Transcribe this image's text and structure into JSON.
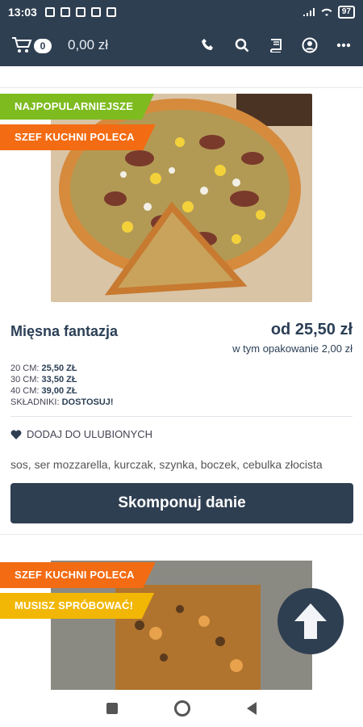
{
  "status_bar": {
    "time": "13:03",
    "battery": "97"
  },
  "header": {
    "cart_count": "0",
    "cart_total": "0,00 zł",
    "icons": [
      "phone-icon",
      "search-icon",
      "menu-book-icon",
      "account-icon",
      "more-icon"
    ]
  },
  "products": [
    {
      "ribbons": [
        "NAJPOPULARNIEJSZE",
        "SZEF KUCHNI POLECA"
      ],
      "title": "Mięsna fantazja",
      "price_from": "od 25,50 zł",
      "packaging": "w tym opakowanie 2,00 zł",
      "sizes": [
        {
          "label": "20 CM:",
          "price": "25,50 ZŁ"
        },
        {
          "label": "30 CM:",
          "price": "33,50 ZŁ"
        },
        {
          "label": "40 CM:",
          "price": "39,00 ZŁ"
        }
      ],
      "ingredients_label": "SKŁADNIKI:",
      "ingredients_link": "DOSTOSUJ!",
      "favorite_label": "DODAJ DO ULUBIONYCH",
      "ingredients": "sos, ser mozzarella, kurczak, szynka, boczek, cebulka złocista",
      "compose_button": "Skomponuj danie"
    },
    {
      "ribbons": [
        "SZEF KUCHNI POLECA",
        "MUSISZ SPRÓBOWAĆ!"
      ]
    }
  ],
  "colors": {
    "primary": "#2f3f52",
    "ribbon_green": "#7dbb1f",
    "ribbon_orange": "#f36b12",
    "ribbon_yellow": "#f2b705"
  }
}
